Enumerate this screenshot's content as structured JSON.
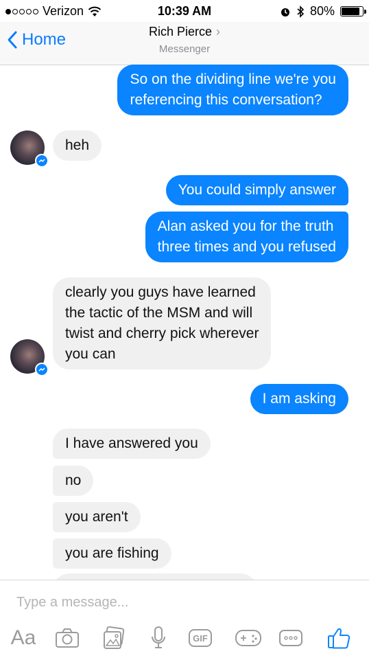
{
  "status_bar": {
    "carrier": "Verizon",
    "signal_bars": 1,
    "signal_total": 5,
    "time": "10:39 AM",
    "battery": "80%"
  },
  "nav": {
    "back_label": "Home",
    "title": "Rich Pierce",
    "subtitle": "Messenger"
  },
  "messages": [
    {
      "from": "me",
      "lines": [
        "So on the dividing line we're you",
        "referencing this conversation?"
      ]
    },
    {
      "from": "them",
      "lines": [
        "heh"
      ]
    },
    {
      "from": "me",
      "lines": [
        "You could simply answer"
      ]
    },
    {
      "from": "me",
      "lines": [
        "Alan asked you for the truth",
        "three times and you refused"
      ]
    },
    {
      "from": "them",
      "lines": [
        "clearly you guys have learned",
        "the tactic of the MSM and will",
        "twist and cherry pick wherever",
        "you can"
      ]
    },
    {
      "from": "me",
      "lines": [
        "I am asking"
      ]
    },
    {
      "from": "them",
      "lines": [
        "I have answered you"
      ]
    },
    {
      "from": "them",
      "lines": [
        "no"
      ]
    },
    {
      "from": "them",
      "lines": [
        "you aren't"
      ]
    },
    {
      "from": "them",
      "lines": [
        "you are fishing"
      ]
    }
  ],
  "composer": {
    "placeholder": "Type a message...",
    "text_format_label": "Aa",
    "gif_label": "GIF",
    "tool_icons": [
      "text-format-icon",
      "camera-icon",
      "photo-gallery-icon",
      "microphone-icon",
      "gif-icon",
      "game-controller-icon",
      "more-icon",
      "like-icon"
    ]
  },
  "colors": {
    "outgoing_bubble": "#0a84ff",
    "incoming_bubble": "#f1f0f0",
    "accent": "#0a7cff"
  }
}
